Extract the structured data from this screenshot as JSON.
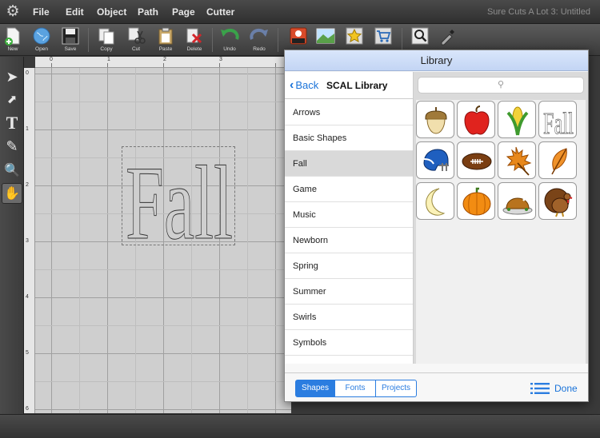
{
  "app": {
    "menus": [
      "File",
      "Edit",
      "Object",
      "Path",
      "Page",
      "Cutter"
    ],
    "window_title": "Sure Cuts A Lot 3: Untitled"
  },
  "toolbar": {
    "new": "New",
    "open": "Open",
    "save": "Save",
    "copy": "Copy",
    "cut": "Cut",
    "paste": "Paste",
    "delete": "Delete",
    "undo": "Undo",
    "redo": "Redo"
  },
  "rulers": {
    "top": [
      "0",
      "1",
      "2",
      "3"
    ],
    "left": [
      "0",
      "1",
      "2",
      "3",
      "4",
      "5",
      "6"
    ]
  },
  "canvas": {
    "art_text": "Fall"
  },
  "library": {
    "title": "Library",
    "back_label": "Back",
    "header": "SCAL Library",
    "categories": [
      "Arrows",
      "Basic Shapes",
      "Fall",
      "Game",
      "Music",
      "Newborn",
      "Spring",
      "Summer",
      "Swirls",
      "Symbols"
    ],
    "selected_category": "Fall",
    "search_placeholder": "",
    "shapes": [
      "acorn",
      "apple",
      "corn",
      "fall-text",
      "football-helmet",
      "football",
      "maple-leaf",
      "leaf",
      "crescent-moon",
      "pumpkin",
      "roast-turkey",
      "turkey"
    ],
    "shape_text": "Fall",
    "tabs": [
      "Shapes",
      "Fonts",
      "Projects"
    ],
    "active_tab": "Shapes",
    "done_label": "Done"
  },
  "colors": {
    "accent": "#2b7de0",
    "title_bar": "#c3d5f4",
    "canvas": "#cfcfcf"
  }
}
